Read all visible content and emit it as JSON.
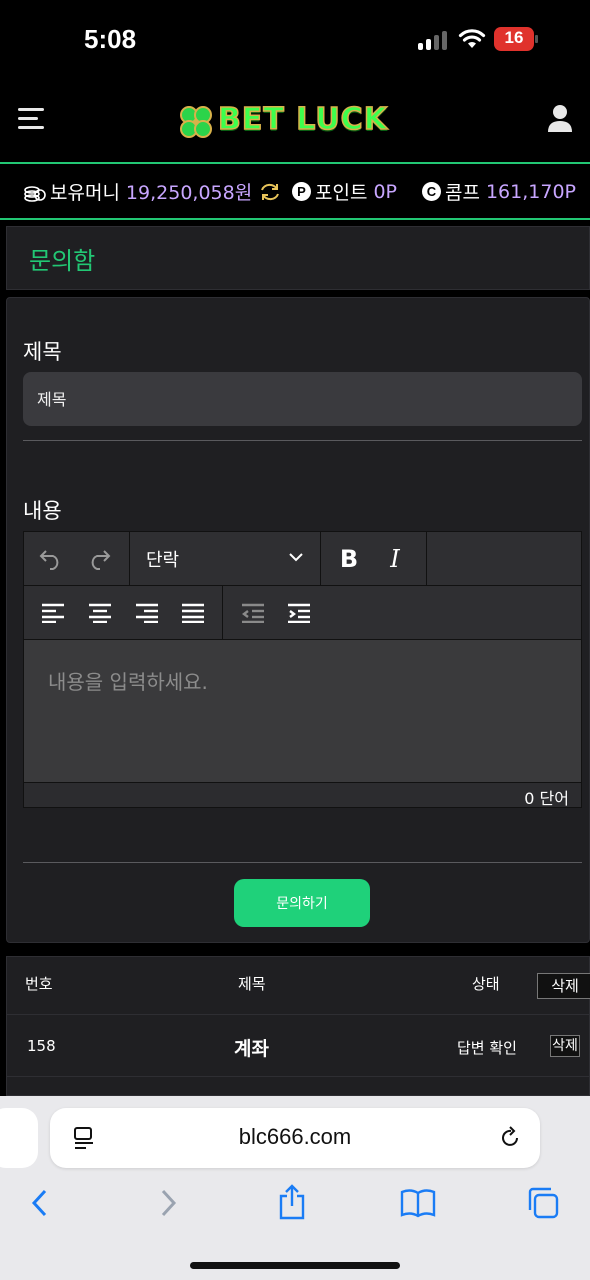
{
  "status_bar": {
    "time": "5:08",
    "battery": "16"
  },
  "header": {
    "logo_text": "BET LUCK"
  },
  "balance": {
    "money_label": "보유머니",
    "money_value": "19,250,058원",
    "point_badge": "P",
    "point_label": "포인트",
    "point_value": "0P",
    "comp_badge": "C",
    "comp_label": "콤프",
    "comp_value": "161,170P"
  },
  "page": {
    "title": "문의함"
  },
  "form": {
    "subject_label": "제목",
    "subject_placeholder": "제목",
    "content_label": "내용",
    "editor": {
      "block_format": "단락",
      "bold_label": "B",
      "italic_label": "I",
      "placeholder": "내용을 입력하세요.",
      "word_count": "0 단어"
    },
    "submit_label": "문의하기"
  },
  "inquiry_list": {
    "headers": {
      "number": "번호",
      "title": "제목",
      "status": "상태",
      "delete": "삭제"
    },
    "rows": [
      {
        "number": "158",
        "title": "계좌",
        "status": "답변 확인",
        "delete": "삭제"
      }
    ]
  },
  "browser": {
    "url": "blc666.com"
  },
  "colors": {
    "accent": "#22c774",
    "value": "#c8a6ff",
    "button": "#1fd17a",
    "safari_blue": "#1a7cf5"
  }
}
